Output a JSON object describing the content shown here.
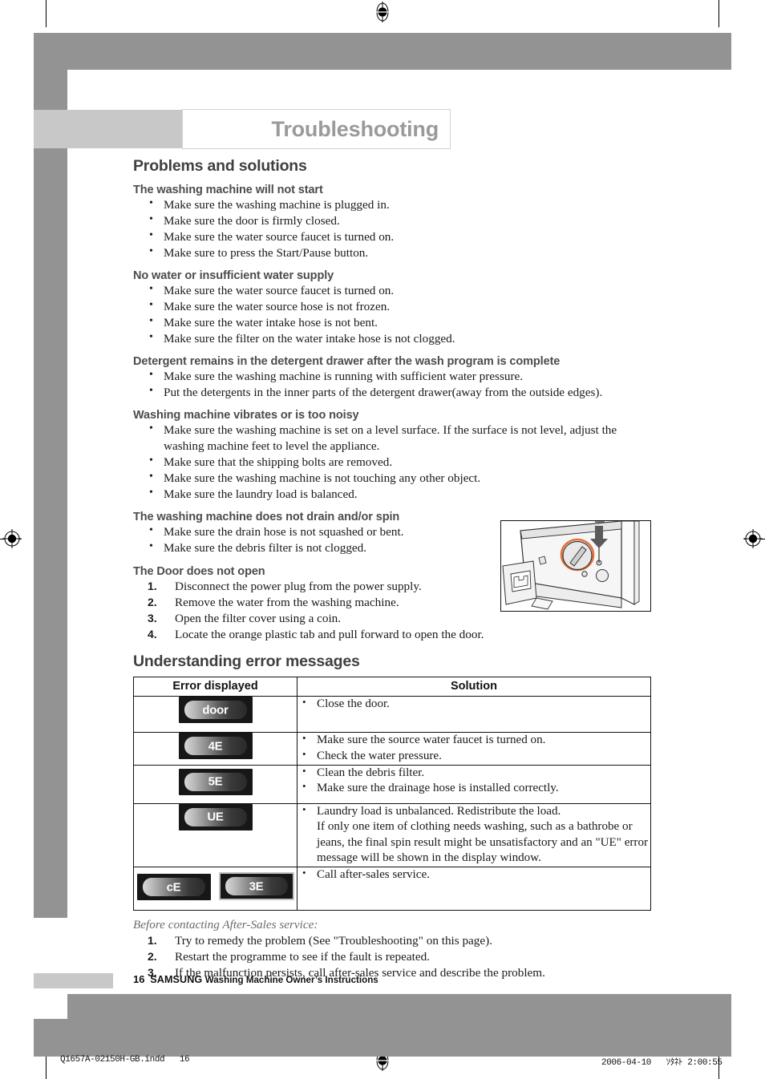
{
  "page": {
    "chapter_title": "Troubleshooting",
    "footer_page_number": "16",
    "footer_brand": "SAMSUNG",
    "footer_rest": "Washing Machine Owner’s Instructions",
    "print_filename": "Q1657A-02150H-GB.indd",
    "print_page": "16",
    "print_date": "2006-04-10",
    "print_time": "ｿﾀﾈﾄ 2:00:55"
  },
  "problems": {
    "heading": "Problems and solutions",
    "groups": [
      {
        "title": "The washing machine will not start",
        "items": [
          "Make sure the washing machine is plugged in.",
          "Make sure the door is firmly closed.",
          "Make sure the water source faucet is turned on.",
          "Make sure to press the Start/Pause button."
        ]
      },
      {
        "title": "No water or insufficient water supply",
        "items": [
          "Make sure the water source faucet is turned on.",
          "Make sure the water source hose is not frozen.",
          "Make sure the water intake hose is not bent.",
          "Make sure the filter on the water intake hose is not clogged."
        ]
      },
      {
        "title": "Detergent remains in the detergent drawer after the wash program is complete",
        "items": [
          "Make sure the washing machine is running with sufficient water pressure.",
          "Put the detergents in the inner parts of the detergent drawer(away from the outside edges)."
        ]
      },
      {
        "title": "Washing machine vibrates or is too noisy",
        "items": [
          "Make sure the washing machine is set on a level surface.  If the surface is not level, adjust the washing machine feet to level the appliance.",
          "Make sure that the shipping bolts are removed.",
          "Make sure the washing machine is not touching any other object.",
          "Make sure the laundry load is balanced."
        ]
      },
      {
        "title": "The washing machine does not drain and/or spin",
        "items": [
          "Make sure the drain hose is not squashed or bent.",
          "Make sure the debris filter is not clogged."
        ]
      }
    ],
    "door_group": {
      "title": "The Door does not open",
      "steps": [
        "Disconnect the power plug from the power supply.",
        "Remove the water from the washing machine.",
        "Open the filter cover using a coin.",
        "Locate the orange plastic tab and pull forward to open the door."
      ]
    }
  },
  "errors": {
    "heading": "Understanding error messages",
    "columns": [
      "Error displayed",
      "Solution"
    ],
    "rows": [
      {
        "displays": [
          "door"
        ],
        "solutions": [
          "Close the door."
        ],
        "continuation": ""
      },
      {
        "displays": [
          "4E"
        ],
        "solutions": [
          "Make sure the source water faucet is turned on.",
          "Check the water pressure."
        ],
        "continuation": ""
      },
      {
        "displays": [
          "5E"
        ],
        "solutions": [
          "Clean the debris filter.",
          "Make sure the drainage hose is installed correctly."
        ],
        "continuation": ""
      },
      {
        "displays": [
          "UE"
        ],
        "solutions": [
          "Laundry load is unbalanced. Redistribute the load."
        ],
        "continuation": "If only one item of clothing needs washing, such as a bathrobe or jeans, the final spin result might be unsatisfactory and an \"UE\" error message will be shown in the display window."
      },
      {
        "displays": [
          "cE",
          "3E"
        ],
        "solutions": [
          "Call after-sales service."
        ],
        "continuation": ""
      }
    ]
  },
  "before_service": {
    "note": "Before contacting After-Sales service:",
    "steps": [
      "Try to remedy the problem (See \"Troubleshooting\" on this page).",
      "Restart the programme to see if the fault is repeated.",
      "If the malfunction persists, call after-sales service and describe the problem."
    ]
  },
  "colors": {
    "band_gray": "#939393",
    "light_gray": "#c8c8c8",
    "title_gray": "#9a9a9a",
    "accent_orange": "#e2703a"
  }
}
